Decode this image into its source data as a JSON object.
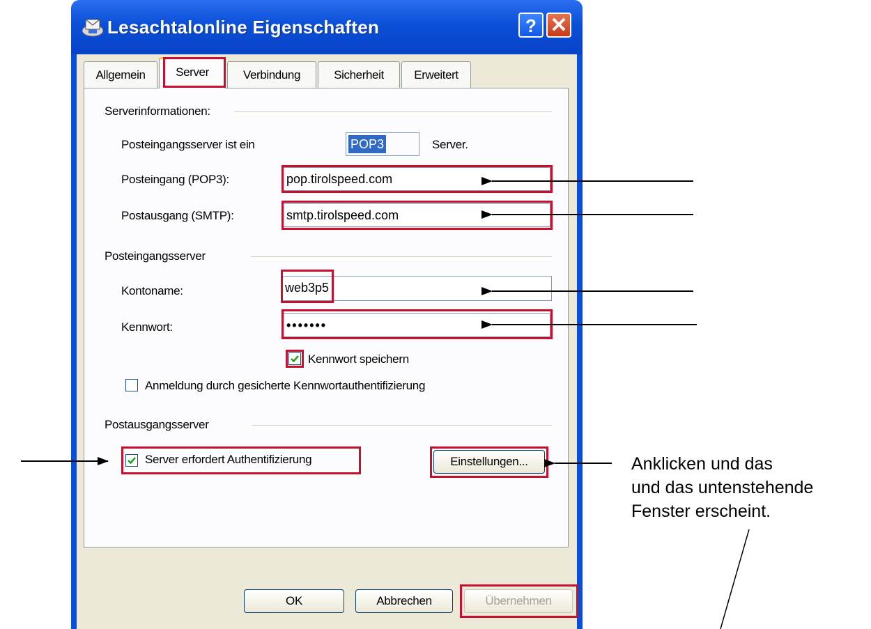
{
  "window": {
    "title": "Lesachtalonline Eigenschaften",
    "help_label": "?",
    "close_label": "✕"
  },
  "tabs": [
    {
      "label": "Allgemein",
      "active": false
    },
    {
      "label": "Server",
      "active": true
    },
    {
      "label": "Verbindung",
      "active": false
    },
    {
      "label": "Sicherheit",
      "active": false
    },
    {
      "label": "Erweitert",
      "active": false
    }
  ],
  "server_info": {
    "group_title": "Serverinformationen:",
    "incoming_type_label": "Posteingangsserver ist ein",
    "incoming_type_value": "POP3",
    "incoming_type_suffix": "Server.",
    "pop3_label": "Posteingang (POP3):",
    "pop3_value": "pop.tirolspeed.com",
    "smtp_label": "Postausgang (SMTP):",
    "smtp_value": "smtp.tirolspeed.com"
  },
  "incoming_server": {
    "group_title": "Posteingangsserver",
    "account_label": "Kontoname:",
    "account_value": "web3p5",
    "password_label": "Kennwort:",
    "password_value": "•••••••",
    "remember_password_label": "Kennwort speichern",
    "remember_password_checked": true,
    "spa_label": "Anmeldung durch gesicherte Kennwortauthentifizierung",
    "spa_checked": false
  },
  "outgoing_server": {
    "group_title": "Postausgangsserver",
    "auth_required_label": "Server erfordert Authentifizierung",
    "auth_required_checked": true,
    "settings_button": "Einstellungen..."
  },
  "footer": {
    "ok_button": "OK",
    "cancel_button": "Abbrechen",
    "apply_button": "Übernehmen"
  },
  "annotation": {
    "line1": "Anklicken und das",
    "line2": "und das untenstehende",
    "line3": "Fenster erscheint."
  },
  "colors": {
    "highlight_red": "#c8102e",
    "titlebar_blue": "#0a4fd8",
    "dialog_bg": "#ece9d8",
    "checkbox_green": "#21a121"
  }
}
